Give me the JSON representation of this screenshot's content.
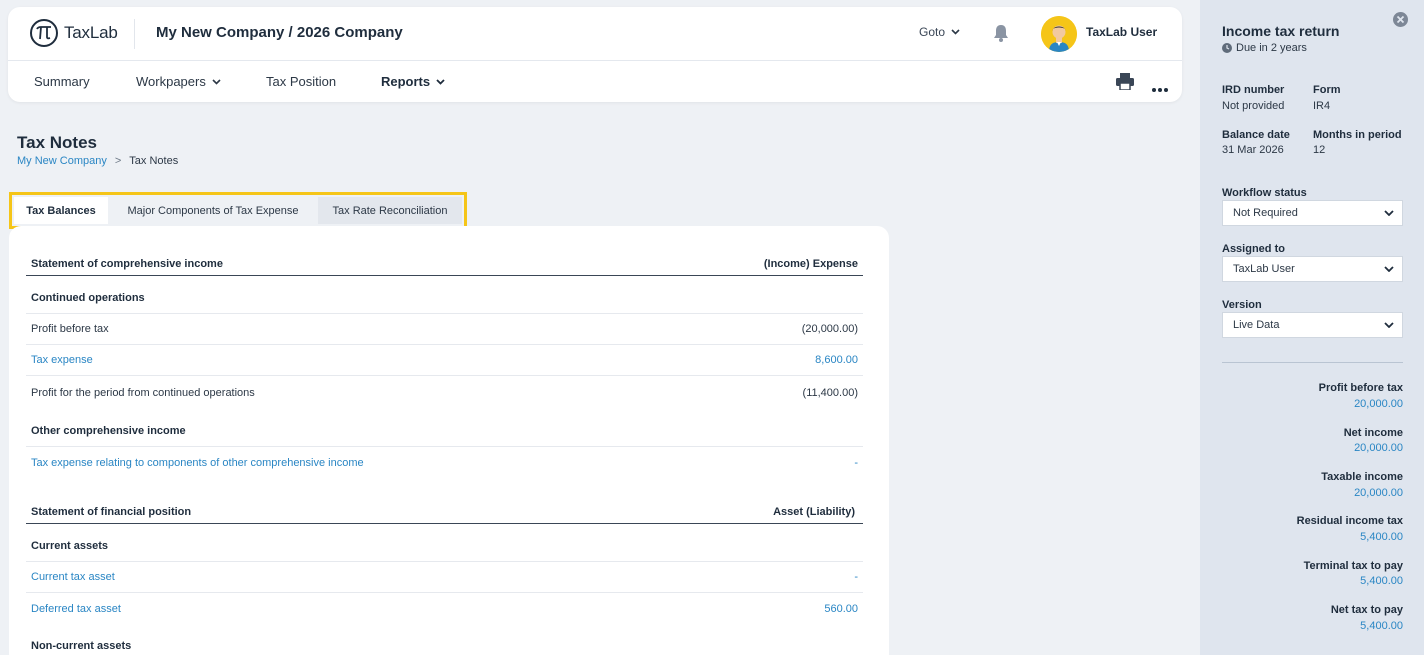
{
  "header": {
    "logo_text": "TaxLab",
    "company": "My New Company / 2026 Company",
    "goto_label": "Goto",
    "user_name": "TaxLab User"
  },
  "nav": {
    "items": [
      {
        "label": "Summary"
      },
      {
        "label": "Workpapers"
      },
      {
        "label": "Tax Position"
      },
      {
        "label": "Reports"
      }
    ]
  },
  "page": {
    "title": "Tax Notes",
    "breadcrumb": {
      "parent": "My New Company",
      "separator": ">",
      "current": "Tax Notes"
    }
  },
  "tabs": [
    {
      "label": "Tax Balances",
      "active": true
    },
    {
      "label": "Major Components of Tax Expense",
      "active": false
    },
    {
      "label": "Tax Rate Reconciliation",
      "active": false
    }
  ],
  "table": {
    "sci_header": {
      "label": "Statement of comprehensive income",
      "value": "(Income) Expense"
    },
    "continued_ops": "Continued operations",
    "profit_before_tax": {
      "label": "Profit before tax",
      "value": "(20,000.00)"
    },
    "tax_expense": {
      "label": "Tax expense",
      "value": "8,600.00"
    },
    "profit_period": {
      "label": "Profit for the period from continued operations",
      "value": "(11,400.00)"
    },
    "oci": "Other comprehensive income",
    "tax_oci": {
      "label": "Tax expense relating to components of other comprehensive income",
      "value": "-"
    },
    "sfp_header": {
      "label": "Statement of financial position",
      "value": "Asset (Liability)"
    },
    "current_assets": "Current assets",
    "current_tax_asset": {
      "label": "Current tax asset",
      "value": "-"
    },
    "deferred_tax_asset": {
      "label": "Deferred tax asset",
      "value": "560.00"
    },
    "non_current_assets": "Non-current assets"
  },
  "panel": {
    "title": "Income tax return",
    "due": "Due in 2 years",
    "ird_label": "IRD number",
    "ird_value": "Not provided",
    "form_label": "Form",
    "form_value": "IR4",
    "balance_label": "Balance date",
    "balance_value": "31 Mar 2026",
    "months_label": "Months in period",
    "months_value": "12",
    "workflow_label": "Workflow status",
    "workflow_value": "Not Required",
    "assigned_label": "Assigned to",
    "assigned_value": "TaxLab User",
    "version_label": "Version",
    "version_value": "Live Data",
    "summary": [
      {
        "label": "Profit before tax",
        "value": "20,000.00"
      },
      {
        "label": "Net income",
        "value": "20,000.00"
      },
      {
        "label": "Taxable income",
        "value": "20,000.00"
      },
      {
        "label": "Residual income tax",
        "value": "5,400.00"
      },
      {
        "label": "Terminal tax to pay",
        "value": "5,400.00"
      },
      {
        "label": "Net tax to pay",
        "value": "5,400.00"
      }
    ]
  },
  "colors": {
    "accent_link": "#2a86c4",
    "highlight": "#f5c518",
    "panel_bg": "#dfe5ee"
  }
}
